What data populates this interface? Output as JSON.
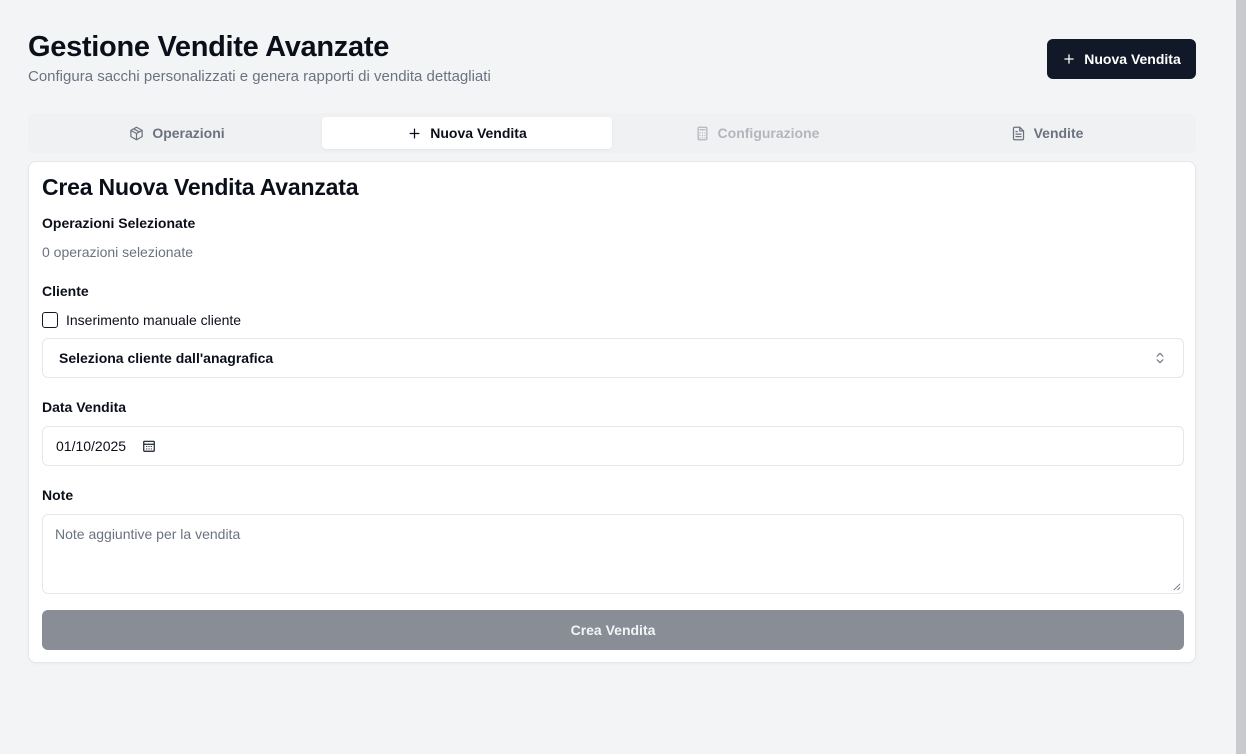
{
  "header": {
    "title": "Gestione Vendite Avanzate",
    "subtitle": "Configura sacchi personalizzati e genera rapporti di vendita dettagliati",
    "new_sale_button": "Nuova Vendita"
  },
  "tabs": [
    {
      "label": "Operazioni",
      "icon": "package-icon",
      "state": "inactive"
    },
    {
      "label": "Nuova Vendita",
      "icon": "plus-icon",
      "state": "active"
    },
    {
      "label": "Configurazione",
      "icon": "calculator-icon",
      "state": "disabled"
    },
    {
      "label": "Vendite",
      "icon": "file-text-icon",
      "state": "inactive"
    }
  ],
  "form": {
    "title": "Crea Nuova Vendita Avanzata",
    "operations_label": "Operazioni Selezionate",
    "operations_count": "0 operazioni selezionate",
    "client_label": "Cliente",
    "manual_client_checkbox": "Inserimento manuale cliente",
    "manual_client_checked": false,
    "client_select_value": "Seleziona cliente dall'anagrafica",
    "date_label": "Data Vendita",
    "date_value": "01/10/2025",
    "notes_label": "Note",
    "notes_placeholder": "Note aggiuntive per la vendita",
    "submit_label": "Crea Vendita"
  },
  "colors": {
    "background": "#f3f4f6",
    "primary": "#111827",
    "submit_disabled": "#898d96",
    "muted_text": "#6b7280"
  }
}
